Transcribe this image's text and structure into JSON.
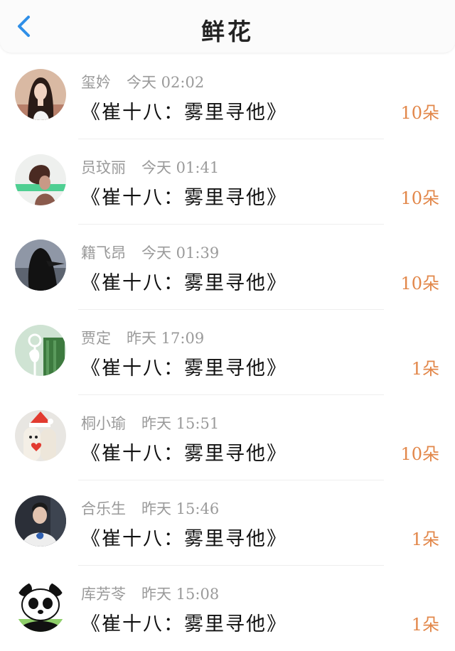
{
  "header": {
    "title": "鲜花",
    "back_icon": "chevron-left-icon",
    "accent_color": "#2f8fe8"
  },
  "count_color": "#e2874a",
  "items": [
    {
      "name": "玺妗",
      "time": "今天 02:02",
      "book": "《崔十八：雾里寻他》",
      "count": "10朵"
    },
    {
      "name": "员玟丽",
      "time": "今天 01:41",
      "book": "《崔十八：雾里寻他》",
      "count": "10朵"
    },
    {
      "name": "籍飞昂",
      "time": "今天 01:39",
      "book": "《崔十八：雾里寻他》",
      "count": "10朵"
    },
    {
      "name": "贾定",
      "time": "昨天 17:09",
      "book": "《崔十八：雾里寻他》",
      "count": "1朵"
    },
    {
      "name": "桐小瑜",
      "time": "昨天 15:51",
      "book": "《崔十八：雾里寻他》",
      "count": "10朵"
    },
    {
      "name": "合乐生",
      "time": "昨天 15:46",
      "book": "《崔十八：雾里寻他》",
      "count": "1朵"
    },
    {
      "name": "库芳苓",
      "time": "昨天 15:08",
      "book": "《崔十八：雾里寻他》",
      "count": "1朵"
    }
  ]
}
